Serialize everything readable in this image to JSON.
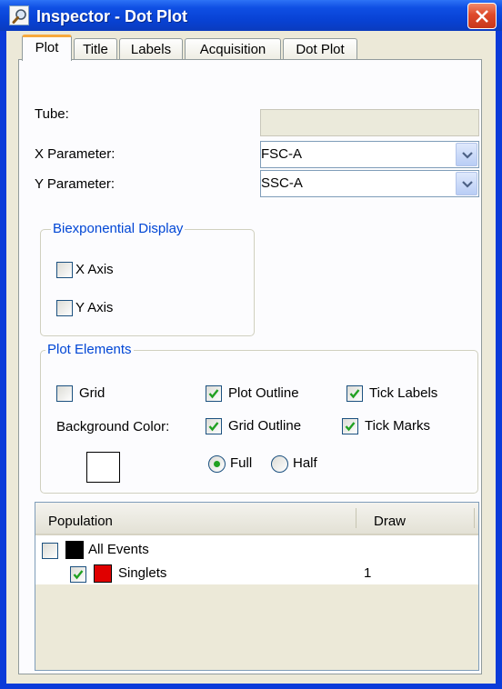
{
  "window": {
    "title": "Inspector - Dot Plot",
    "colors": {
      "titlebar": "#0842d4",
      "close": "#de4a2a",
      "tab_highlight": "#f7a93c",
      "group_title": "#0046d5"
    }
  },
  "tabs": [
    {
      "label": "Plot",
      "active": true
    },
    {
      "label": "Title",
      "active": false
    },
    {
      "label": "Labels",
      "active": false
    },
    {
      "label": "Acquisition",
      "active": false
    },
    {
      "label": "Dot Plot",
      "active": false
    }
  ],
  "fields": {
    "tube": {
      "label": "Tube:",
      "value": ""
    },
    "x_param": {
      "label": "X Parameter:",
      "value": "FSC-A"
    },
    "y_param": {
      "label": "Y Parameter:",
      "value": "SSC-A"
    }
  },
  "biexp": {
    "title": "Biexponential Display",
    "x_axis": {
      "label": "X Axis",
      "checked": false
    },
    "y_axis": {
      "label": "Y Axis",
      "checked": false
    }
  },
  "plot_elements": {
    "title": "Plot Elements",
    "grid": {
      "label": "Grid",
      "checked": false
    },
    "plot_outline": {
      "label": "Plot Outline",
      "checked": true
    },
    "tick_labels": {
      "label": "Tick Labels",
      "checked": true
    },
    "background_color_label": "Background Color:",
    "background_color": "#ffffff",
    "grid_outline": {
      "label": "Grid Outline",
      "checked": true
    },
    "tick_marks": {
      "label": "Tick Marks",
      "checked": true
    },
    "full": {
      "label": "Full",
      "selected": true
    },
    "half": {
      "label": "Half",
      "selected": false
    }
  },
  "populations": {
    "columns": [
      "Population",
      "Draw"
    ],
    "rows": [
      {
        "name": "All Events",
        "checked": false,
        "color": "#000000",
        "draw": ""
      },
      {
        "name": "Singlets",
        "checked": true,
        "color": "#e00000",
        "draw": "1"
      }
    ]
  },
  "icons": [
    "magnifier-icon",
    "close-icon",
    "chevron-down-icon",
    "checkmark-icon"
  ]
}
